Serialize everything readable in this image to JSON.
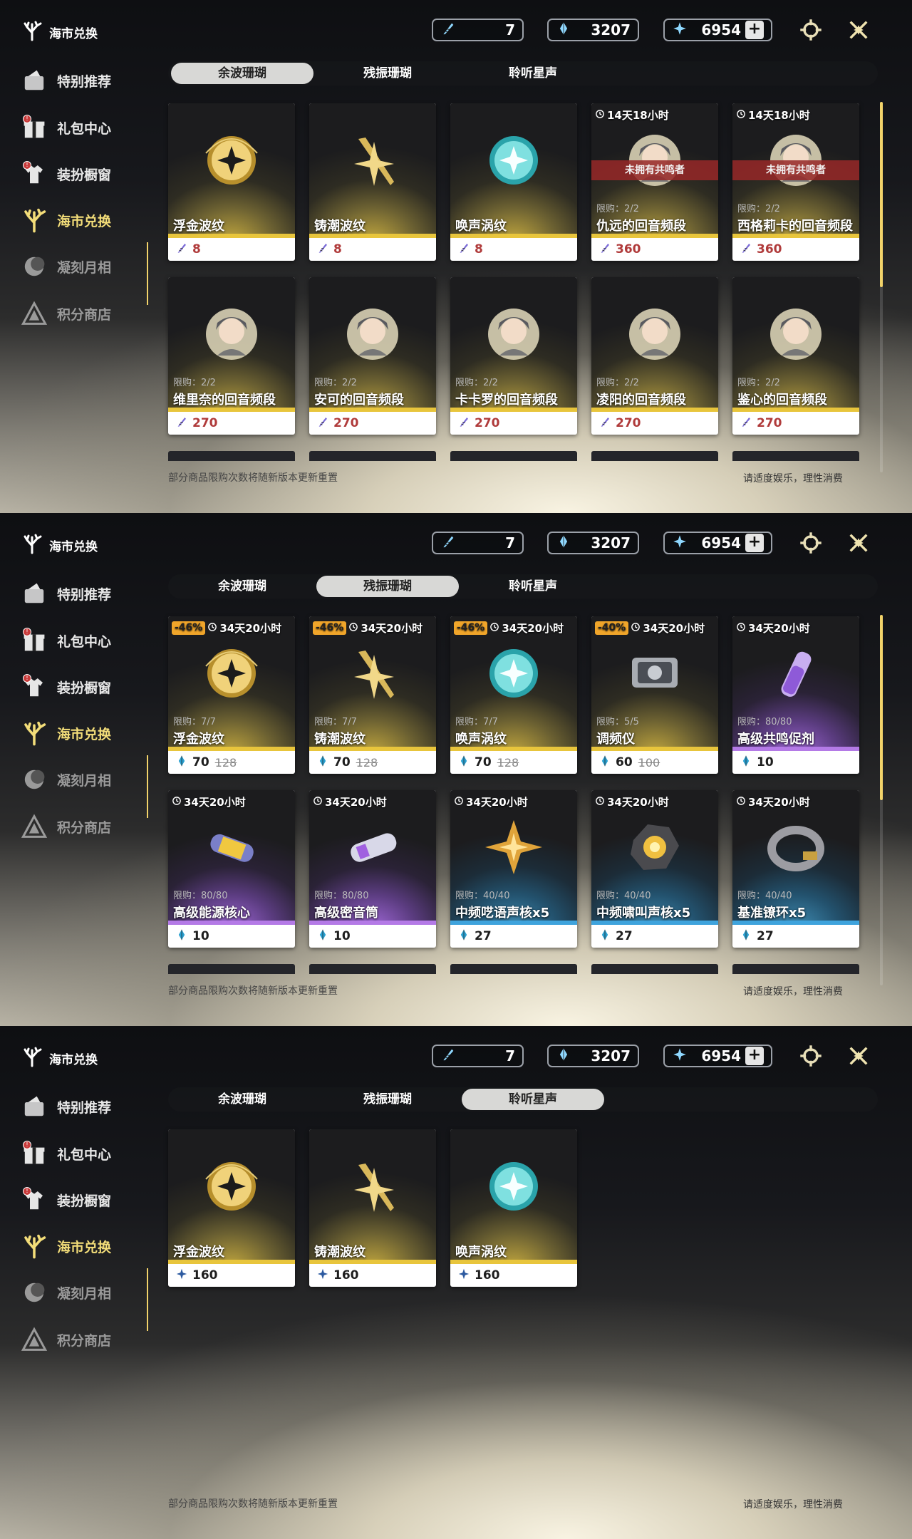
{
  "screens": [
    {
      "active_tab": 0,
      "sidebar": {
        "title": "海市兑换",
        "items": [
          "特别推荐",
          "礼包中心",
          "装扮橱窗",
          "海市兑换",
          "凝刻月相",
          "积分商店"
        ]
      },
      "currency": [
        "7",
        "3207",
        "6954"
      ],
      "tabs": [
        "余波珊瑚",
        "残振珊瑚",
        "聆听星声"
      ],
      "cards": [
        {
          "name": "浮金波纹",
          "price": "8",
          "icon": "sphere-gold-icon",
          "art": "gold"
        },
        {
          "name": "铸潮波纹",
          "price": "8",
          "icon": "blade-gold-icon",
          "art": "gold"
        },
        {
          "name": "唤声涡纹",
          "price": "8",
          "icon": "sphere-teal-icon",
          "art": "gold"
        },
        {
          "name": "仇远的回音频段",
          "price": "360",
          "timer": "14天18小时",
          "limit": "限购：2/2",
          "banner": "未拥有共鸣者",
          "icon": "portrait-icon",
          "art": "gold"
        },
        {
          "name": "西格莉卡的回音频段",
          "price": "360",
          "timer": "14天18小时",
          "limit": "限购：2/2",
          "banner": "未拥有共鸣者",
          "icon": "portrait-icon",
          "art": "gold"
        },
        {
          "name": "维里奈的回音频段",
          "price": "270",
          "limit": "限购：2/2",
          "icon": "portrait-icon",
          "art": "gold"
        },
        {
          "name": "安可的回音频段",
          "price": "270",
          "limit": "限购：2/2",
          "icon": "portrait-icon",
          "art": "gold"
        },
        {
          "name": "卡卡罗的回音频段",
          "price": "270",
          "limit": "限购：2/2",
          "icon": "portrait-icon",
          "art": "gold"
        },
        {
          "name": "凌阳的回音频段",
          "price": "270",
          "limit": "限购：2/2",
          "icon": "portrait-icon",
          "art": "gold"
        },
        {
          "name": "鉴心的回音频段",
          "price": "270",
          "limit": "限购：2/2",
          "icon": "portrait-icon",
          "art": "gold"
        }
      ],
      "note_left": "部分商品限购次数将随新版本更新重置",
      "note_right": "请适度娱乐，理性消费"
    },
    {
      "active_tab": 1,
      "sidebar": {
        "title": "海市兑换",
        "items": [
          "特别推荐",
          "礼包中心",
          "装扮橱窗",
          "海市兑换",
          "凝刻月相",
          "积分商店"
        ]
      },
      "currency": [
        "7",
        "3207",
        "6954"
      ],
      "tabs": [
        "余波珊瑚",
        "残振珊瑚",
        "聆听星声"
      ],
      "cards": [
        {
          "name": "浮金波纹",
          "price": "70",
          "old": "128",
          "discount": "-46%",
          "timer": "34天20小时",
          "limit": "限购：7/7",
          "icon": "sphere-gold-icon",
          "art": "gold"
        },
        {
          "name": "铸潮波纹",
          "price": "70",
          "old": "128",
          "discount": "-46%",
          "timer": "34天20小时",
          "limit": "限购：7/7",
          "icon": "blade-gold-icon",
          "art": "gold"
        },
        {
          "name": "唤声涡纹",
          "price": "70",
          "old": "128",
          "discount": "-46%",
          "timer": "34天20小时",
          "limit": "限购：7/7",
          "icon": "sphere-teal-icon",
          "art": "gold"
        },
        {
          "name": "调频仪",
          "price": "60",
          "old": "100",
          "discount": "-40%",
          "timer": "34天20小时",
          "limit": "限购：5/5",
          "icon": "device-icon",
          "art": "gold"
        },
        {
          "name": "高级共鸣促剂",
          "price": "10",
          "timer": "34天20小时",
          "limit": "限购：80/80",
          "icon": "vial-icon",
          "art": "purple"
        },
        {
          "name": "高级能源核心",
          "price": "10",
          "timer": "34天20小时",
          "limit": "限购：80/80",
          "icon": "capsule-icon",
          "art": "purple"
        },
        {
          "name": "高级密音筒",
          "price": "10",
          "timer": "34天20小时",
          "limit": "限购：80/80",
          "icon": "cylinder-icon",
          "art": "purple"
        },
        {
          "name": "中频呓语声核x5",
          "price": "27",
          "timer": "34天20小时",
          "limit": "限购：40/40",
          "icon": "star-core-icon",
          "art": "blue"
        },
        {
          "name": "中频啸叫声核x5",
          "price": "27",
          "timer": "34天20小时",
          "limit": "限购：40/40",
          "icon": "orb-core-icon",
          "art": "blue"
        },
        {
          "name": "基准镣环x5",
          "price": "27",
          "timer": "34天20小时",
          "limit": "限购：40/40",
          "icon": "ring-icon",
          "art": "blue"
        }
      ],
      "note_left": "部分商品限购次数将随新版本更新重置",
      "note_right": "请适度娱乐，理性消费"
    },
    {
      "active_tab": 2,
      "sidebar": {
        "title": "海市兑换",
        "items": [
          "特别推荐",
          "礼包中心",
          "装扮橱窗",
          "海市兑换",
          "凝刻月相",
          "积分商店"
        ]
      },
      "currency": [
        "7",
        "3207",
        "6954"
      ],
      "tabs": [
        "余波珊瑚",
        "残振珊瑚",
        "聆听星声"
      ],
      "cards": [
        {
          "name": "浮金波纹",
          "price": "160",
          "icon": "sphere-gold-icon",
          "art": "gold"
        },
        {
          "name": "铸潮波纹",
          "price": "160",
          "icon": "blade-gold-icon",
          "art": "gold"
        },
        {
          "name": "唤声涡纹",
          "price": "160",
          "icon": "sphere-teal-icon",
          "art": "gold"
        }
      ],
      "note_left": "部分商品限购次数将随新版本更新重置",
      "note_right": "请适度娱乐，理性消费"
    }
  ]
}
